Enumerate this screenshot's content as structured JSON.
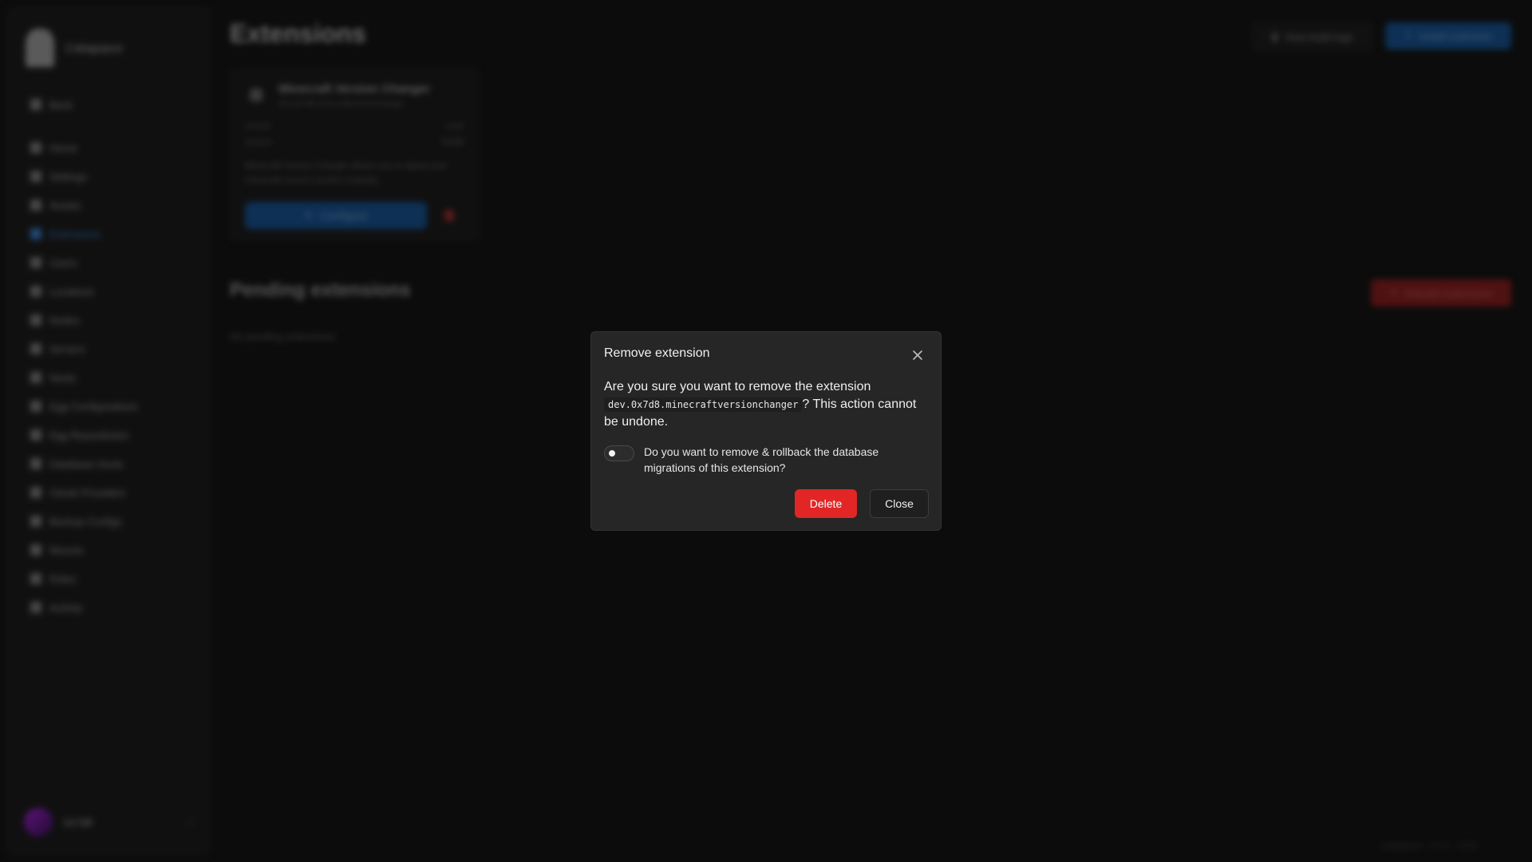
{
  "sidebar": {
    "brand": "Calagopus",
    "back_label": "Back",
    "items": [
      {
        "label": "Home",
        "icon": "home-icon"
      },
      {
        "label": "Settings",
        "icon": "wrench-icon"
      },
      {
        "label": "Assets",
        "icon": "folder-icon"
      },
      {
        "label": "Extensions",
        "icon": "puzzle-icon",
        "active": true
      },
      {
        "label": "Users",
        "icon": "users-icon"
      },
      {
        "label": "Locations",
        "icon": "globe-icon"
      },
      {
        "label": "Nodes",
        "icon": "server-icon"
      },
      {
        "label": "Servers",
        "icon": "monitor-icon"
      },
      {
        "label": "Nests",
        "icon": "feather-icon"
      },
      {
        "label": "Egg Configurations",
        "icon": "egg-icon"
      },
      {
        "label": "Egg Repositories",
        "icon": "repo-icon"
      },
      {
        "label": "Database Hosts",
        "icon": "database-icon"
      },
      {
        "label": "OAuth Providers",
        "icon": "key-icon"
      },
      {
        "label": "Backup Configs",
        "icon": "archive-icon"
      },
      {
        "label": "Mounts",
        "icon": "mount-icon"
      },
      {
        "label": "Roles",
        "icon": "tag-icon"
      },
      {
        "label": "Activity",
        "icon": "activity-icon"
      }
    ],
    "user": {
      "name": "0x7d8"
    }
  },
  "header": {
    "title": "Extensions",
    "logs_button": "View build logs",
    "install_button": "Install extension"
  },
  "extension_card": {
    "name": "Minecraft Version Changer",
    "identifier": "dev.0x7d8.minecraftversionchanger",
    "meta": [
      {
        "label": "Version",
        "value": "1.0.0"
      },
      {
        "label": "Authors",
        "value": "0x7d8"
      }
    ],
    "description": "Minecraft Version Changer allows you to adjust your minecraft servers version instantly.",
    "configure_button": "Configure"
  },
  "pending": {
    "title": "Pending extensions",
    "rebuild_button": "Rebuild extensions",
    "empty_text": "No pending extensions"
  },
  "footer": {
    "text": "Calagopus · 1.0.0 · 2025"
  },
  "modal": {
    "title": "Remove extension",
    "body_prefix": "Are you sure you want to remove the extension",
    "extension_id": "dev.0x7d8.minecraftversionchanger",
    "body_suffix": "? This action cannot be undone.",
    "toggle_label": "Do you want to remove & rollback the database migrations of this extension?",
    "toggle_on": false,
    "delete_button": "Delete",
    "close_button": "Close"
  },
  "colors": {
    "danger": "#e22626",
    "primary": "#154a82",
    "background": "#131313",
    "modal": "#262626"
  }
}
